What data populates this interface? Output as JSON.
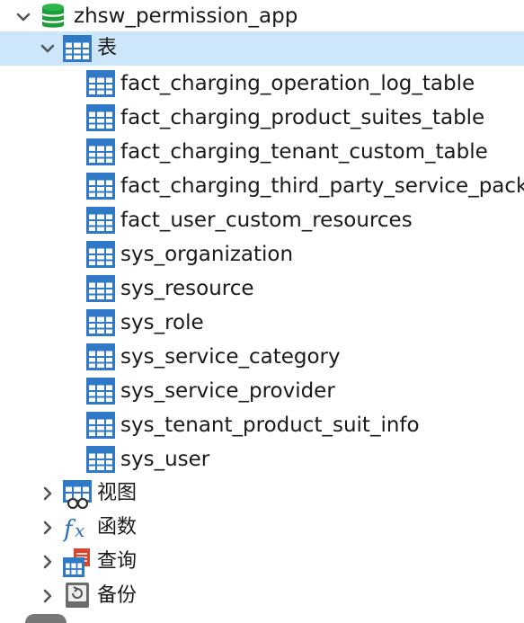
{
  "tree": {
    "database": {
      "label": "zhsw_permission_app",
      "icon": "database-icon",
      "expanded": true
    },
    "tables_folder": {
      "label": "表",
      "icon": "tables-folder-icon",
      "expanded": true,
      "selected": true
    },
    "tables": [
      "fact_charging_operation_log_table",
      "fact_charging_product_suites_table",
      "fact_charging_tenant_custom_table",
      "fact_charging_third_party_service_pack",
      "fact_user_custom_resources",
      "sys_organization",
      "sys_resource",
      "sys_role",
      "sys_service_category",
      "sys_service_provider",
      "sys_tenant_product_suit_info",
      "sys_user"
    ],
    "collapsed_nodes": [
      {
        "label": "视图",
        "icon": "view-icon"
      },
      {
        "label": "函数",
        "icon": "function-icon"
      },
      {
        "label": "查询",
        "icon": "query-icon"
      },
      {
        "label": "备份",
        "icon": "backup-icon"
      }
    ]
  },
  "colors": {
    "selection": "#cde6fb",
    "table_icon_blue": "#2f79c6",
    "database_green": "#1e9e3a",
    "chevron": "#555555",
    "function_blue": "#2a6cc7",
    "query_red": "#d9452f"
  }
}
